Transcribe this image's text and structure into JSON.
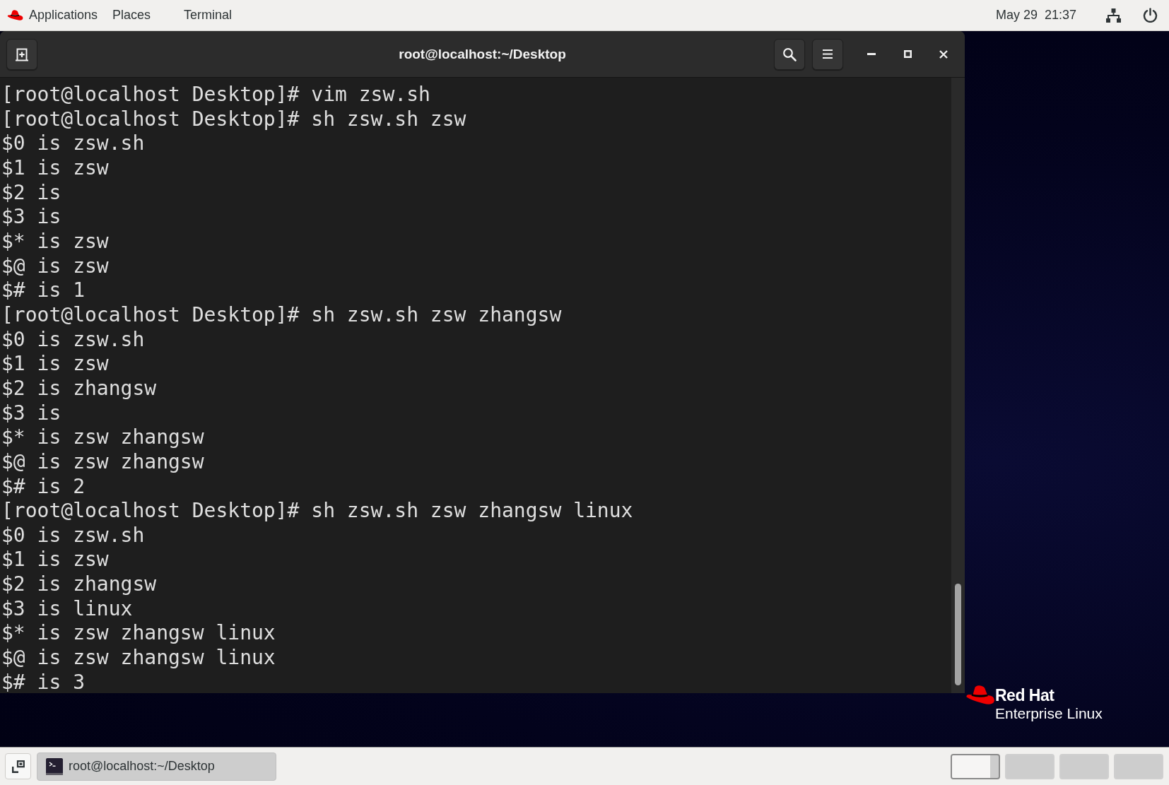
{
  "top_bar": {
    "menus": [
      {
        "label": "Applications"
      },
      {
        "label": "Places"
      }
    ],
    "app_menu": {
      "label": "Terminal"
    },
    "clock": "May 29  21:37"
  },
  "terminal": {
    "title": "root@localhost:~/Desktop",
    "lines": [
      "[root@localhost Desktop]# vim zsw.sh",
      "[root@localhost Desktop]# sh zsw.sh zsw",
      "$0 is zsw.sh",
      "$1 is zsw",
      "$2 is",
      "$3 is",
      "$* is zsw",
      "$@ is zsw",
      "$# is 1",
      "[root@localhost Desktop]# sh zsw.sh zsw zhangsw",
      "$0 is zsw.sh",
      "$1 is zsw",
      "$2 is zhangsw",
      "$3 is",
      "$* is zsw zhangsw",
      "$@ is zsw zhangsw",
      "$# is 2",
      "[root@localhost Desktop]# sh zsw.sh zsw zhangsw linux",
      "$0 is zsw.sh",
      "$1 is zsw",
      "$2 is zhangsw",
      "$3 is linux",
      "$* is zsw zhangsw linux",
      "$@ is zsw zhangsw linux",
      "$# is 3"
    ]
  },
  "desktop_logo": {
    "brand": "Red Hat",
    "product": "Enterprise Linux"
  },
  "taskbar": {
    "windows": [
      {
        "label": "root@localhost:~/Desktop",
        "selected": true
      }
    ],
    "workspaces": [
      {
        "selected": true,
        "has_window": true
      },
      {
        "selected": false,
        "has_window": false
      },
      {
        "selected": false,
        "has_window": false
      },
      {
        "selected": false,
        "has_window": false
      }
    ]
  }
}
